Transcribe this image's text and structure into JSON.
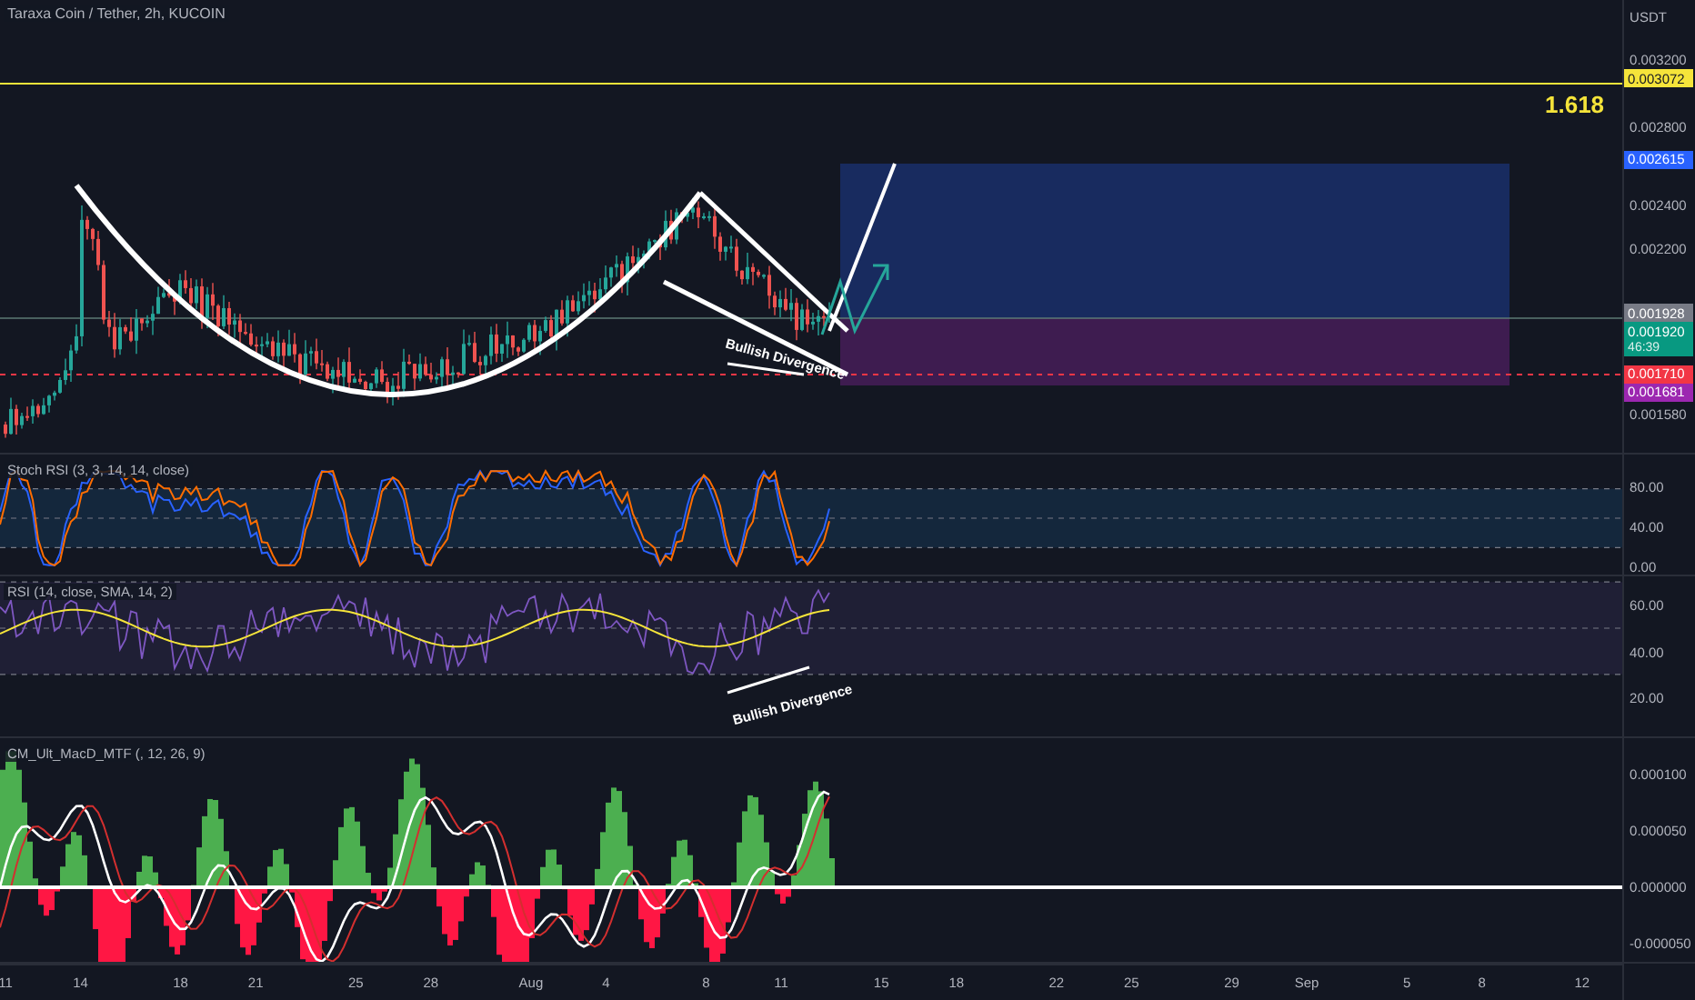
{
  "chart": {
    "title": "Taraxa Coin / Tether, 2h, KUCOIN",
    "fib_label": "1.618",
    "annotation": "Bullish Divergence"
  },
  "price_scale": {
    "currency": "USDT",
    "ticks": [
      {
        "label": "0.003200"
      },
      {
        "label": "0.002800"
      },
      {
        "label": "0.002400"
      },
      {
        "label": "0.002200"
      },
      {
        "label": "0.001580"
      }
    ],
    "badges": [
      {
        "label": "0.003072",
        "color": "#f5e43a"
      },
      {
        "label": "0.002615",
        "color": "#2962ff"
      },
      {
        "label": "0.001928",
        "color": "#787b86"
      },
      {
        "label": "0.001920",
        "countdown": "46:39",
        "color": "#089981"
      },
      {
        "label": "0.001710",
        "color": "#f23645"
      },
      {
        "label": "0.001681",
        "color": "#9c27b0"
      }
    ]
  },
  "panes": [
    {
      "kind": "stoch_rsi",
      "title": "Stoch RSI (3, 3, 14, 14, close)",
      "ticks": [
        {
          "label": "80.00"
        },
        {
          "label": "40.00"
        },
        {
          "label": "0.00"
        }
      ]
    },
    {
      "kind": "rsi",
      "title": "RSI (14, close, SMA, 14, 2)",
      "annotation": "Bullish Divergence",
      "ticks": [
        {
          "label": "60.00"
        },
        {
          "label": "40.00"
        },
        {
          "label": "20.00"
        }
      ]
    },
    {
      "kind": "macd",
      "title": "CM_Ult_MacD_MTF (, 12, 26, 9)",
      "ticks": [
        {
          "label": "0.000100"
        },
        {
          "label": "0.000050"
        },
        {
          "label": "0.000000"
        },
        {
          "label": "-0.000050"
        }
      ]
    }
  ],
  "time_axis": [
    "11",
    "14",
    "18",
    "21",
    "25",
    "28",
    "Aug",
    "4",
    "8",
    "11",
    "15",
    "18",
    "22",
    "25",
    "29",
    "Sep",
    "5",
    "8",
    "12"
  ]
}
